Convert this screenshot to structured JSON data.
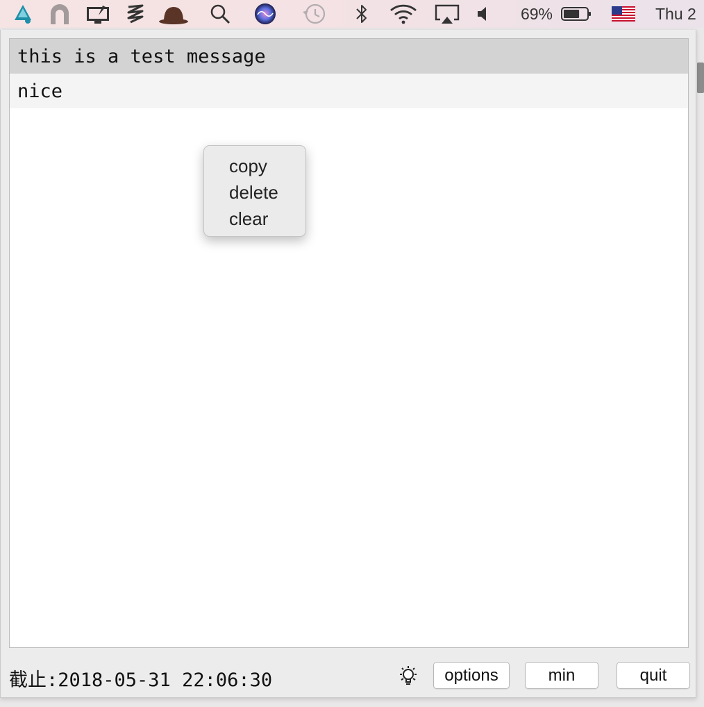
{
  "menubar": {
    "icons": [
      "megaphone-icon",
      "arch-icon",
      "screen-share-icon",
      "z-scribble-icon",
      "bowler-hat-icon",
      "search-icon",
      "siri-icon",
      "time-machine-icon",
      "bluetooth-icon",
      "wifi-icon",
      "airplay-icon",
      "volume-icon",
      "battery-icon",
      "us-flag-icon"
    ],
    "battery_percent": "69%",
    "battery_level": 0.69,
    "clock": "Thu 2"
  },
  "list": {
    "items": [
      {
        "text": "this is a test message",
        "selected": true
      },
      {
        "text": "nice",
        "selected": false
      }
    ]
  },
  "context_menu": {
    "items": [
      "copy",
      "delete",
      "clear"
    ]
  },
  "footer": {
    "status": "截止:2018-05-31 22:06:30",
    "options_label": "options",
    "min_label": "min",
    "quit_label": "quit"
  },
  "colors": {
    "selected_row": "#d3d3d3",
    "alt_row": "#f4f4f4",
    "accent_teal": "#1f8fa8",
    "hat_brown": "#5a3426"
  }
}
